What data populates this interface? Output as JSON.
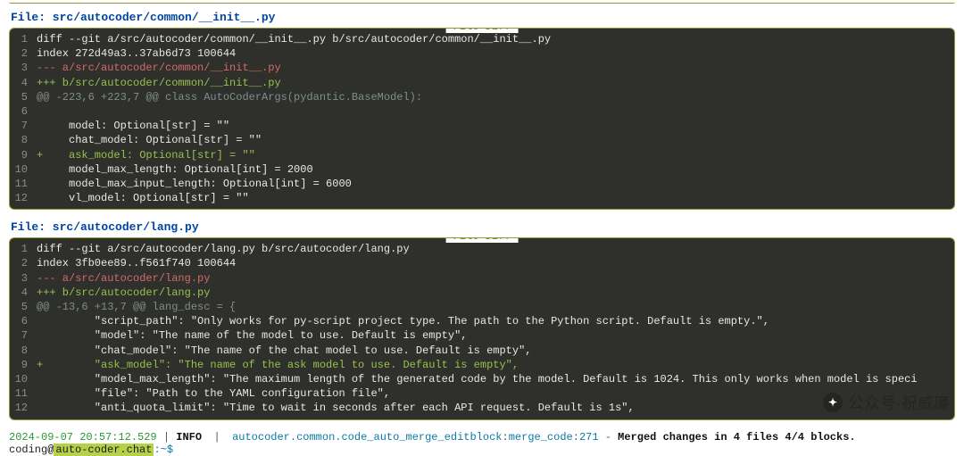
{
  "diff_label": "File Diff",
  "files": [
    {
      "header": "File: src/autocoder/common/__init__.py",
      "lines": [
        {
          "n": 1,
          "cls": "normal",
          "text": "diff --git a/src/autocoder/common/__init__.py b/src/autocoder/common/__init__.py"
        },
        {
          "n": 2,
          "cls": "normal",
          "text": "index 272d49a3..37ab6d73 100644"
        },
        {
          "n": 3,
          "cls": "del",
          "text": "--- a/src/autocoder/common/__init__.py"
        },
        {
          "n": 4,
          "cls": "add",
          "text": "+++ b/src/autocoder/common/__init__.py"
        },
        {
          "n": 5,
          "cls": "hunk",
          "text": "@@ -223,6 +223,7 @@ class AutoCoderArgs(pydantic.BaseModel):"
        },
        {
          "n": 6,
          "cls": "normal",
          "text": ""
        },
        {
          "n": 7,
          "cls": "normal",
          "text": "     model: Optional[str] = \"\""
        },
        {
          "n": 8,
          "cls": "normal",
          "text": "     chat_model: Optional[str] = \"\""
        },
        {
          "n": 9,
          "cls": "add",
          "text": "+    ask_model: Optional[str] = \"\""
        },
        {
          "n": 10,
          "cls": "normal",
          "text": "     model_max_length: Optional[int] = 2000"
        },
        {
          "n": 11,
          "cls": "normal",
          "text": "     model_max_input_length: Optional[int] = 6000"
        },
        {
          "n": 12,
          "cls": "normal",
          "text": "     vl_model: Optional[str] = \"\""
        }
      ]
    },
    {
      "header": "File: src/autocoder/lang.py",
      "lines": [
        {
          "n": 1,
          "cls": "normal",
          "text": "diff --git a/src/autocoder/lang.py b/src/autocoder/lang.py"
        },
        {
          "n": 2,
          "cls": "normal",
          "text": "index 3fb0ee89..f561f740 100644"
        },
        {
          "n": 3,
          "cls": "del",
          "text": "--- a/src/autocoder/lang.py"
        },
        {
          "n": 4,
          "cls": "add",
          "text": "+++ b/src/autocoder/lang.py"
        },
        {
          "n": 5,
          "cls": "hunk",
          "text": "@@ -13,6 +13,7 @@ lang_desc = {"
        },
        {
          "n": 6,
          "cls": "normal",
          "text": "         \"script_path\": \"Only works for py-script project type. The path to the Python script. Default is empty.\","
        },
        {
          "n": 7,
          "cls": "normal",
          "text": "         \"model\": \"The name of the model to use. Default is empty\","
        },
        {
          "n": 8,
          "cls": "normal",
          "text": "         \"chat_model\": \"The name of the chat model to use. Default is empty\","
        },
        {
          "n": 9,
          "cls": "add",
          "text": "+        \"ask_model\": \"The name of the ask model to use. Default is empty\","
        },
        {
          "n": 10,
          "cls": "normal",
          "text": "         \"model_max_length\": \"The maximum length of the generated code by the model. Default is 1024. This only works when model is speci"
        },
        {
          "n": 11,
          "cls": "normal",
          "text": "         \"file\": \"Path to the YAML configuration file\","
        },
        {
          "n": 12,
          "cls": "normal",
          "text": "         \"anti_quota_limit\": \"Time to wait in seconds after each API request. Default is 1s\","
        }
      ]
    }
  ],
  "status": {
    "timestamp": "2024-09-07 20:57:12.529",
    "sep": " | ",
    "level": "INFO",
    "module": "autocoder.common.code_auto_merge_editblock",
    "colon": ":",
    "func": "merge_code",
    "line": "271",
    "dash": " - ",
    "message": "Merged changes in 4 files 4/4 blocks."
  },
  "prompt": {
    "user": "coding",
    "at": "@",
    "host": "auto-coder.chat",
    "path": ":~$ "
  },
  "watermark": {
    "label": "公众号·祝威廉"
  }
}
